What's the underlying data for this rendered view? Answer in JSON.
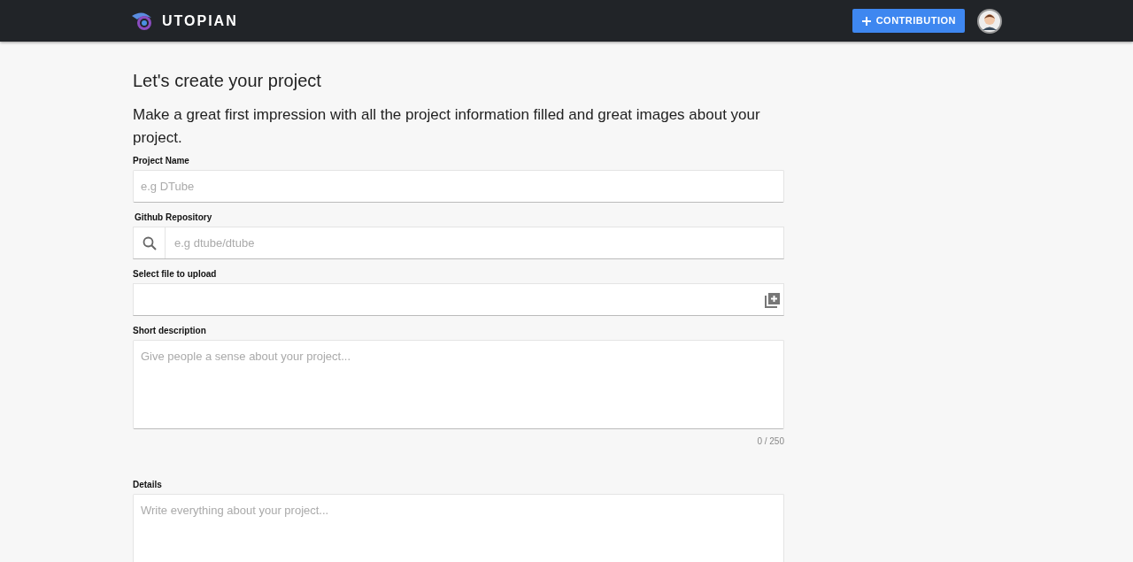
{
  "header": {
    "brand": "UTOPIAN",
    "contribution_button": "CONTRIBUTION"
  },
  "heading": "Let's create your project",
  "subheading": "Make a great first impression with all the project information filled and great images about your project.",
  "fields": [
    {
      "kind": "text",
      "label": "Project Name",
      "placeholder": "e.g DTube"
    },
    {
      "kind": "search",
      "label": "Github Repository",
      "placeholder": "e.g dtube/dtube"
    },
    {
      "kind": "file",
      "label": "Select file to upload"
    },
    {
      "kind": "textarea",
      "label": "Short description",
      "placeholder": "Give people a sense about your project...",
      "counter": "0 / 250"
    },
    {
      "kind": "textarea",
      "label": "Details",
      "placeholder": "Write everything about your project..."
    }
  ]
}
